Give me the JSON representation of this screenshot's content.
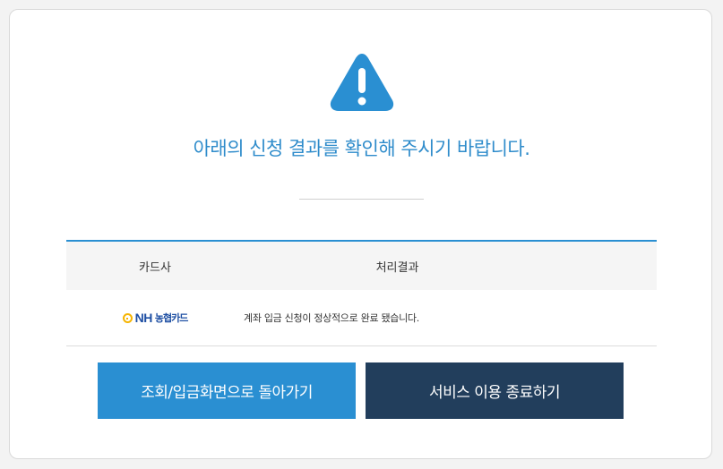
{
  "dialog": {
    "heading": "아래의 신청 결과를 확인해 주시기 바랍니다.",
    "accent_color": "#2a8fd2",
    "icon": "warning-triangle-icon"
  },
  "table": {
    "columns": [
      "카드사",
      "처리결과"
    ],
    "rows": [
      {
        "card_company_logo": {
          "mark": "NH",
          "text": "농협카드"
        },
        "result": "계좌 입금 신청이 정상적으로 완료 됐습니다."
      }
    ]
  },
  "buttons": {
    "back_label": "조회/입금화면으로 돌아가기",
    "exit_label": "서비스 이용 종료하기"
  }
}
